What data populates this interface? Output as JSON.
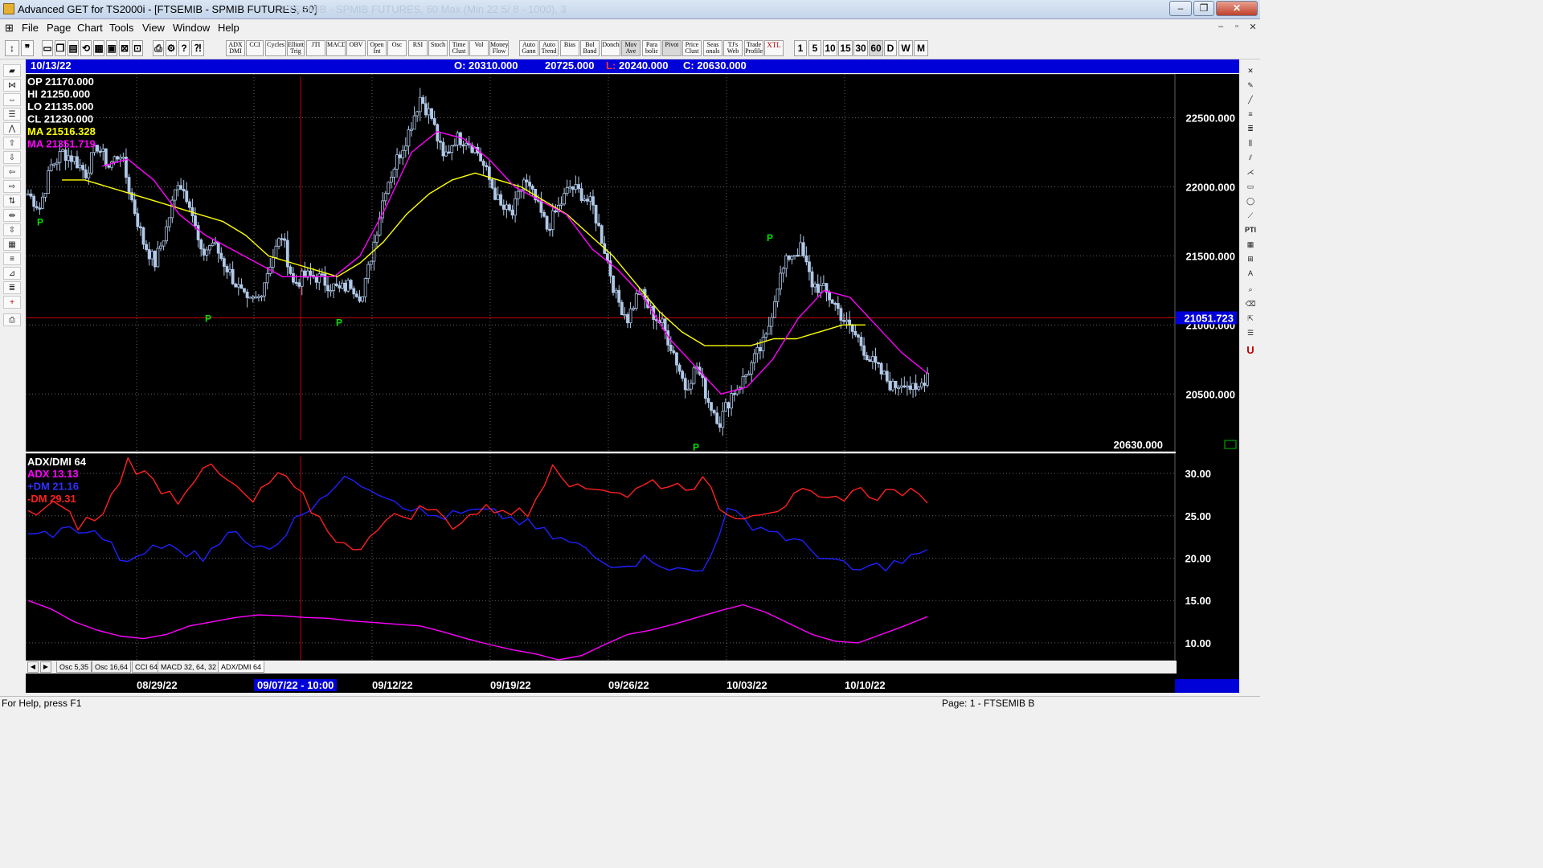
{
  "window": {
    "title": "Advanced GET for TS2000i - [FTSEMIB - SPMIB FUTURES, 60]",
    "ghost_title": "FTSEMIB - SPMIB FUTURES, 60 Max (Min 22 5/ 8 - 1000), 3",
    "minimize_label": "–",
    "restore_label": "❐",
    "close_label": "✕"
  },
  "menu": {
    "items": [
      "File",
      "Page",
      "Chart",
      "Tools",
      "View",
      "Window",
      "Help"
    ],
    "child_minimize": "–",
    "child_restore": "▫",
    "child_close": "✕"
  },
  "toolbar": {
    "study_buttons": [
      "ADX DMI",
      "CCI",
      "Cycles",
      "Elliott Trig",
      "JTI",
      "MACD",
      "OBV",
      "Open Int",
      "Osc",
      "RSI",
      "Stoch",
      "Time Clust",
      "Vol",
      "Money Flow"
    ],
    "extra_buttons": [
      "Auto Gann",
      "Auto Trend",
      "Bias",
      "Bol Band",
      "Donch",
      "Mov Ave",
      "Para bolic",
      "Pivot",
      "Price Clust",
      "Seas onals",
      "TJ's Web",
      "Trade Profile",
      "XTL"
    ],
    "timeframes": [
      "1",
      "5",
      "10",
      "15",
      "30",
      "60",
      "D",
      "W",
      "M"
    ],
    "selected_timeframe": "60"
  },
  "header": {
    "date": "10/13/22",
    "open": "O: 20310.000",
    "high": "20725.000",
    "low_label": "L:",
    "low": "20240.000",
    "close": "C: 20630.000"
  },
  "price_panel": {
    "legend": [
      {
        "label": "OP",
        "value": "21170.000",
        "color": "#ffffff"
      },
      {
        "label": "HI",
        "value": "21250.000",
        "color": "#ffffff"
      },
      {
        "label": "LO",
        "value": "21135.000",
        "color": "#ffffff"
      },
      {
        "label": "CL",
        "value": "21230.000",
        "color": "#ffffff"
      },
      {
        "label": "MA",
        "value": "21516.328",
        "color": "#ffff00"
      },
      {
        "label": "MA",
        "value": "21351.719",
        "color": "#ff00ff"
      }
    ],
    "y_ticks": [
      "22500.000",
      "22000.000",
      "21500.000",
      "21000.000",
      "20500.000"
    ],
    "crosshair_price": "21051.723",
    "last_close": "20630.000",
    "pivot_label": "P"
  },
  "indicator_panel": {
    "title": "ADX/DMI 64",
    "legend": [
      {
        "label": "ADX",
        "value": "13.13",
        "color": "#ff00ff"
      },
      {
        "label": "+DM",
        "value": "21.16",
        "color": "#3030ff"
      },
      {
        "label": "-DM",
        "value": "29.31",
        "color": "#ff2020"
      }
    ],
    "y_ticks": [
      "30.00",
      "25.00",
      "20.00",
      "15.00",
      "10.00"
    ]
  },
  "tabs": [
    "Osc 5,35",
    "Osc 16,64",
    "CCI 64",
    "MACD 32, 64, 32",
    "ADX/DMI 64"
  ],
  "active_tab": "ADX/DMI 64",
  "dates": [
    "08/29/22",
    "09/12/22",
    "09/19/22",
    "09/26/22",
    "10/03/22",
    "10/10/22"
  ],
  "cursor_date": "09/07/22 - 10:00",
  "status": {
    "help": "For Help, press F1",
    "page": "Page: 1 - FTSEMIB B"
  },
  "colors": {
    "chart_bg": "#000000",
    "candles": "#b0c8e8",
    "ma_fast": "#ffff00",
    "ma_slow": "#ff00ff",
    "pivot": "#00e000",
    "info_bar": "#0000d8",
    "dm_plus": "#2020ff",
    "dm_minus": "#ff2020",
    "adx": "#ff00ff",
    "crosshair": "#c00000"
  },
  "chart_data": [
    {
      "type": "line",
      "title": "",
      "ylabel": "",
      "ylim": [
        20100,
        22800
      ],
      "x_ticks": [
        "08/29/22",
        "09/12/22",
        "09/19/22",
        "09/26/22",
        "10/03/22",
        "10/10/22"
      ],
      "series": [
        {
          "name": "",
          "values": [
            21950,
            21850,
            22150,
            22250,
            22200,
            22100,
            22300,
            22150,
            22250,
            21900,
            21600,
            21450,
            21700,
            22050,
            21900,
            21500,
            21600,
            21450,
            21300,
            21150,
            21200,
            21450,
            21650,
            21300,
            21350,
            21350,
            21300,
            21250,
            21300,
            21200,
            21600,
            22000,
            22200,
            22400,
            22650,
            22500,
            22200,
            22350,
            22350,
            22250,
            22050,
            21850,
            21800,
            22050,
            21900,
            21700,
            21850,
            22000,
            21950,
            21850,
            21550,
            21200,
            21050,
            21250,
            21100,
            21000,
            20800,
            20550,
            20700,
            20450,
            20300,
            20500,
            20600,
            20750,
            20900,
            21300,
            21500,
            21550,
            21300,
            21250,
            21150,
            21000,
            20900,
            20750,
            20650,
            20550,
            20600,
            20500,
            20650
          ]
        },
        {
          "name": "MA",
          "values": [
            22050,
            22050,
            22000,
            21950,
            21900,
            21850,
            21800,
            21750,
            21650,
            21500,
            21450,
            21400,
            21350,
            21450,
            21600,
            21800,
            21950,
            22050,
            22100,
            22050,
            22000,
            21900,
            21800,
            21650,
            21500,
            21300,
            21100,
            20950,
            20850,
            20850,
            20850,
            20900,
            20900,
            20950,
            21000,
            21000
          ]
        },
        {
          "name": "MA",
          "values": [
            22150,
            22200,
            22050,
            21800,
            21650,
            21550,
            21450,
            21350,
            21350,
            21350,
            21500,
            21850,
            22250,
            22400,
            22350,
            22200,
            22000,
            21900,
            21800,
            21550,
            21400,
            21200,
            20900,
            20700,
            20500,
            20550,
            20750,
            21050,
            21250,
            21200,
            21000,
            20800,
            20650
          ]
        }
      ]
    },
    {
      "type": "line",
      "title": "",
      "ylim": [
        8,
        32
      ],
      "series": [
        {
          "name": "ADX",
          "values": [
            15,
            14,
            12.5,
            11.5,
            10.8,
            10.5,
            11,
            12,
            12.5,
            13,
            13.3,
            13.2,
            13,
            12.9,
            12.6,
            12.4,
            12.2,
            12,
            11.3,
            10.5,
            9.8,
            9.2,
            8.7,
            8,
            8.5,
            9.8,
            11,
            11.5,
            12.2,
            13,
            13.8,
            14.5,
            13.6,
            12.3,
            11,
            10.2,
            10,
            11,
            12,
            13.1
          ]
        },
        {
          "name": "+DM",
          "values": [
            22.5,
            23,
            23.5,
            22.5,
            19,
            21.5,
            21,
            20,
            23.5,
            21,
            22,
            25.5,
            28,
            29.5,
            28,
            26.5,
            25,
            25,
            25.5,
            25,
            24,
            22.5,
            21.5,
            19.5,
            19.5,
            20,
            18.5,
            18.5,
            25.5,
            24,
            23,
            21.5,
            20,
            18.5,
            19,
            19.5,
            21
          ]
        },
        {
          "name": "-DM",
          "values": [
            25,
            26.5,
            24,
            25,
            31.5,
            29,
            27,
            31,
            29,
            26.5,
            30,
            27,
            23.5,
            20.5,
            24,
            25,
            26,
            24,
            25.5,
            26,
            25,
            31.5,
            28,
            28.5,
            27.5,
            29,
            28.5,
            29,
            25,
            25.5,
            26,
            27.5,
            26.5,
            28,
            27.5,
            28,
            26.5
          ]
        }
      ]
    }
  ]
}
